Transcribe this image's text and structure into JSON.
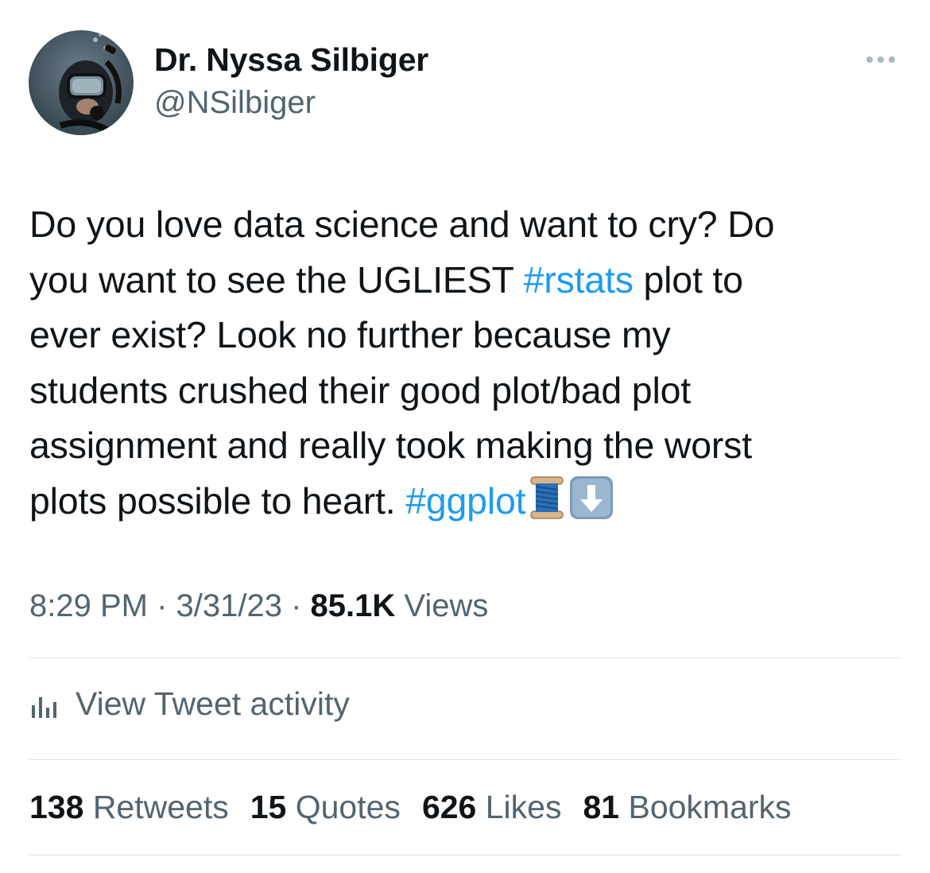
{
  "author": {
    "display_name": "Dr. Nyssa Silbiger",
    "handle": "@NSilbiger",
    "avatar_icon": "scuba-diver-avatar"
  },
  "more_icon": "ellipsis-icon",
  "tweet": {
    "lines": [
      [
        "Do you love data science and want to cry? Do"
      ],
      [
        "you want to see the UGLIEST ",
        "#rstats",
        " plot to"
      ],
      [
        "ever exist?  Look no further because my"
      ],
      [
        "students crushed their good plot/bad plot"
      ],
      [
        "assignment and really took making the worst"
      ],
      [
        "plots possible to heart.  ",
        "#ggplot"
      ]
    ],
    "line2_prefix": "you want to see the UGLIEST ",
    "hashtag_rstats": "#rstats",
    "line2_suffix": " plot to",
    "line6_prefix": "plots possible to heart.  ",
    "hashtag_ggplot": "#ggplot",
    "emojis": [
      "thread-spool-emoji",
      "down-arrow-emoji"
    ],
    "hashtag_color": "#1d9bf0"
  },
  "meta": {
    "time": "8:29 PM",
    "sep1": " · ",
    "date": "3/31/23",
    "sep2": " · ",
    "views_count": "85.1K",
    "views_label": " Views"
  },
  "activity": {
    "label": "View Tweet activity",
    "icon": "bar-chart-icon"
  },
  "stats": {
    "retweets_count": "138",
    "retweets_label": " Retweets",
    "quotes_count": "15",
    "quotes_label": " Quotes",
    "likes_count": "626",
    "likes_label": " Likes",
    "bookmarks_count": "81",
    "bookmarks_label": " Bookmarks"
  },
  "colors": {
    "text_primary": "#0f1419",
    "text_secondary": "#536471",
    "link": "#1d9bf0",
    "divider": "#dfe3e6"
  }
}
